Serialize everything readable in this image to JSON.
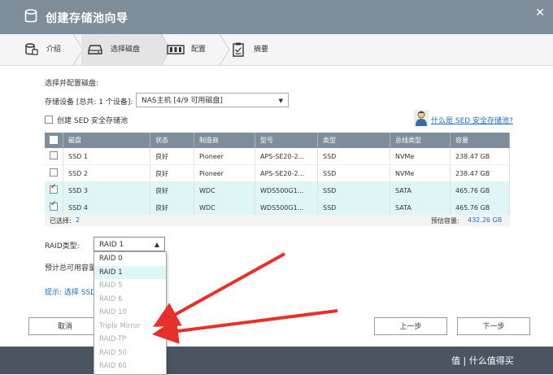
{
  "window": {
    "title": "创建存储池向导",
    "close_symbol": "✕"
  },
  "steps": [
    {
      "label": "介绍",
      "icon": "database-icon"
    },
    {
      "label": "选择磁盘",
      "icon": "disk-drive-icon"
    },
    {
      "label": "配置",
      "icon": "raid-config-icon"
    },
    {
      "label": "摘要",
      "icon": "clipboard-checklist-icon"
    }
  ],
  "form": {
    "section_title": "选择并配置磁盘:",
    "device_label": "存储设备 [总共: 1 个设备]:",
    "device_value": "NAS主机 [4/9 可用磁盘]",
    "sed_label": "创建 SED 安全存储池",
    "sed_link": "什么是 SED 安全存储池?"
  },
  "table": {
    "headers": [
      "磁盘",
      "状态",
      "制造商",
      "型号",
      "类型",
      "总线类型",
      "容量"
    ],
    "rows": [
      {
        "checked": false,
        "cells": [
          "SSD 1",
          "良好",
          "Pioneer",
          "APS-SE20-2...",
          "SSD",
          "NVMe",
          "238.47 GB"
        ]
      },
      {
        "checked": false,
        "cells": [
          "SSD 2",
          "良好",
          "Pioneer",
          "APS-SE20-2...",
          "SSD",
          "NVMe",
          "238.47 GB"
        ]
      },
      {
        "checked": true,
        "cells": [
          "SSD 3",
          "良好",
          "WDC",
          "WDS500G1...",
          "SSD",
          "SATA",
          "465.76 GB"
        ]
      },
      {
        "checked": true,
        "cells": [
          "SSD 4",
          "良好",
          "WDC",
          "WDS500G1...",
          "SSD",
          "SATA",
          "465.76 GB"
        ]
      }
    ],
    "selected_label": "已选择:",
    "selected_count": "2",
    "capacity_label": "预估容量:",
    "capacity_value": "432.26 GB"
  },
  "raid": {
    "label": "RAID类型:",
    "selected": "RAID 1",
    "options": [
      {
        "label": "RAID 0",
        "enabled": true,
        "selected": false
      },
      {
        "label": "RAID 1",
        "enabled": true,
        "selected": true
      },
      {
        "label": "RAID 5",
        "enabled": false,
        "selected": false
      },
      {
        "label": "RAID 6",
        "enabled": false,
        "selected": false
      },
      {
        "label": "RAID 10",
        "enabled": false,
        "selected": false
      },
      {
        "label": "Triple Mirror",
        "enabled": false,
        "selected": false
      },
      {
        "label": "RAID-TP",
        "enabled": false,
        "selected": false
      },
      {
        "label": "RAID 50",
        "enabled": false,
        "selected": false
      },
      {
        "label": "RAID 60",
        "enabled": false,
        "selected": false
      }
    ],
    "estimate_label": "预计总可用容量",
    "tip_text": "提示: 选择 SSD"
  },
  "buttons": {
    "cancel": "取消",
    "prev": "上一步",
    "next": "下一步"
  },
  "watermark": {
    "text": "值 | 什么值得买"
  },
  "colors": {
    "accent": "#7d8d9a",
    "selected_row": "#dff6f6",
    "link": "#1a6dc7",
    "arrow": "#e8302a"
  }
}
